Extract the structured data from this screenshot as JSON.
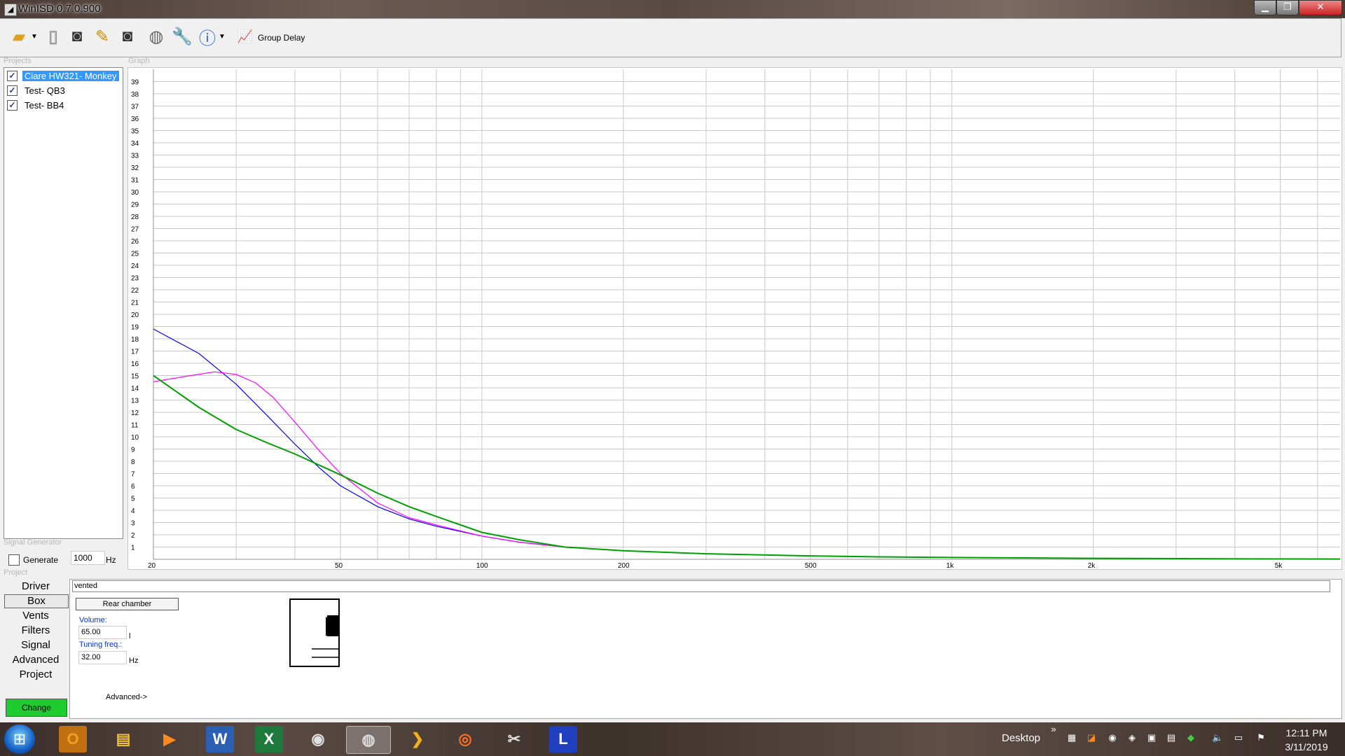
{
  "window": {
    "title": "WinISD 0.7.0.900"
  },
  "toolbar": {
    "group_delay_label": "Group Delay"
  },
  "sections": {
    "projects": "Projects",
    "graph": "Graph",
    "signal_generator": "Signal Generator",
    "project": "Project"
  },
  "projects": [
    {
      "name": "Ciare HW321- Monkey",
      "checked": "✓",
      "selected": true
    },
    {
      "name": "Test- QB3",
      "checked": "✓",
      "selected": false
    },
    {
      "name": "Test- BB4",
      "checked": "✓",
      "selected": false
    }
  ],
  "signal_generator": {
    "generate_label": "Generate",
    "frequency": "1000",
    "unit": "Hz"
  },
  "nav": [
    {
      "label": "Driver",
      "active": false
    },
    {
      "label": "Box",
      "active": true
    },
    {
      "label": "Vents",
      "active": false
    },
    {
      "label": "Filters",
      "active": false
    },
    {
      "label": "Signal",
      "active": false
    },
    {
      "label": "Advanced",
      "active": false
    },
    {
      "label": "Project",
      "active": false
    }
  ],
  "change_button": "Change",
  "box": {
    "type": "vented",
    "rear_chamber_label": "Rear chamber",
    "volume_label": "Volume:",
    "volume_value": "65.00",
    "volume_unit": "l",
    "tuning_label": "Tuning freq.:",
    "tuning_value": "32.00",
    "tuning_unit": "Hz",
    "advanced_link": "Advanced->"
  },
  "chart_data": {
    "type": "line",
    "title": "",
    "xlabel": "",
    "ylabel": "",
    "x_scale": "log",
    "xlim": [
      20,
      6700
    ],
    "ylim": [
      0,
      40
    ],
    "x_tick_labels": [
      {
        "value": 20,
        "label": "20"
      },
      {
        "value": 50,
        "label": "50"
      },
      {
        "value": 100,
        "label": "100"
      },
      {
        "value": 200,
        "label": "200"
      },
      {
        "value": 500,
        "label": "500"
      },
      {
        "value": 1000,
        "label": "1k"
      },
      {
        "value": 2000,
        "label": "2k"
      },
      {
        "value": 5000,
        "label": "5k"
      }
    ],
    "y_ticks": [
      1,
      2,
      3,
      4,
      5,
      6,
      7,
      8,
      9,
      10,
      11,
      12,
      13,
      14,
      15,
      16,
      17,
      18,
      19,
      20,
      21,
      22,
      23,
      24,
      25,
      26,
      27,
      28,
      29,
      30,
      31,
      32,
      33,
      34,
      35,
      36,
      37,
      38,
      39
    ],
    "grid": true,
    "series": [
      {
        "color": "#0000ff",
        "x": [
          20,
          25,
          30,
          35,
          40,
          45,
          50,
          60,
          70,
          80,
          100,
          120,
          150,
          200,
          300,
          500,
          700,
          1000,
          2000,
          5000,
          6700
        ],
        "y": [
          18.8,
          16.8,
          14.3,
          11.7,
          9.4,
          7.5,
          6.0,
          4.3,
          3.3,
          2.7,
          1.9,
          1.4,
          1.0,
          0.7,
          0.45,
          0.28,
          0.2,
          0.15,
          0.08,
          0.03,
          0.02
        ]
      },
      {
        "color": "#ff00ff",
        "x": [
          20,
          24,
          27,
          30,
          33,
          36,
          40,
          45,
          50,
          60,
          70,
          80,
          100,
          120,
          150,
          200,
          300,
          500,
          700,
          1000,
          2000,
          5000,
          6700
        ],
        "y": [
          14.5,
          15.0,
          15.3,
          15.1,
          14.4,
          13.2,
          11.2,
          8.9,
          7.0,
          4.6,
          3.4,
          2.8,
          1.9,
          1.4,
          1.0,
          0.7,
          0.45,
          0.28,
          0.2,
          0.15,
          0.08,
          0.03,
          0.02
        ]
      },
      {
        "color": "#00a000",
        "x": [
          20,
          25,
          30,
          35,
          40,
          45,
          50,
          60,
          70,
          80,
          100,
          120,
          150,
          200,
          300,
          500,
          700,
          1000,
          2000,
          5000,
          6700
        ],
        "y": [
          15.0,
          12.4,
          10.6,
          9.5,
          8.6,
          7.7,
          6.9,
          5.4,
          4.3,
          3.5,
          2.2,
          1.6,
          1.0,
          0.7,
          0.45,
          0.28,
          0.2,
          0.15,
          0.08,
          0.03,
          0.02
        ]
      }
    ]
  },
  "taskbar": {
    "desktop_label": "Desktop",
    "chevron": "»",
    "time": "12:11 PM",
    "date": "3/11/2019"
  }
}
